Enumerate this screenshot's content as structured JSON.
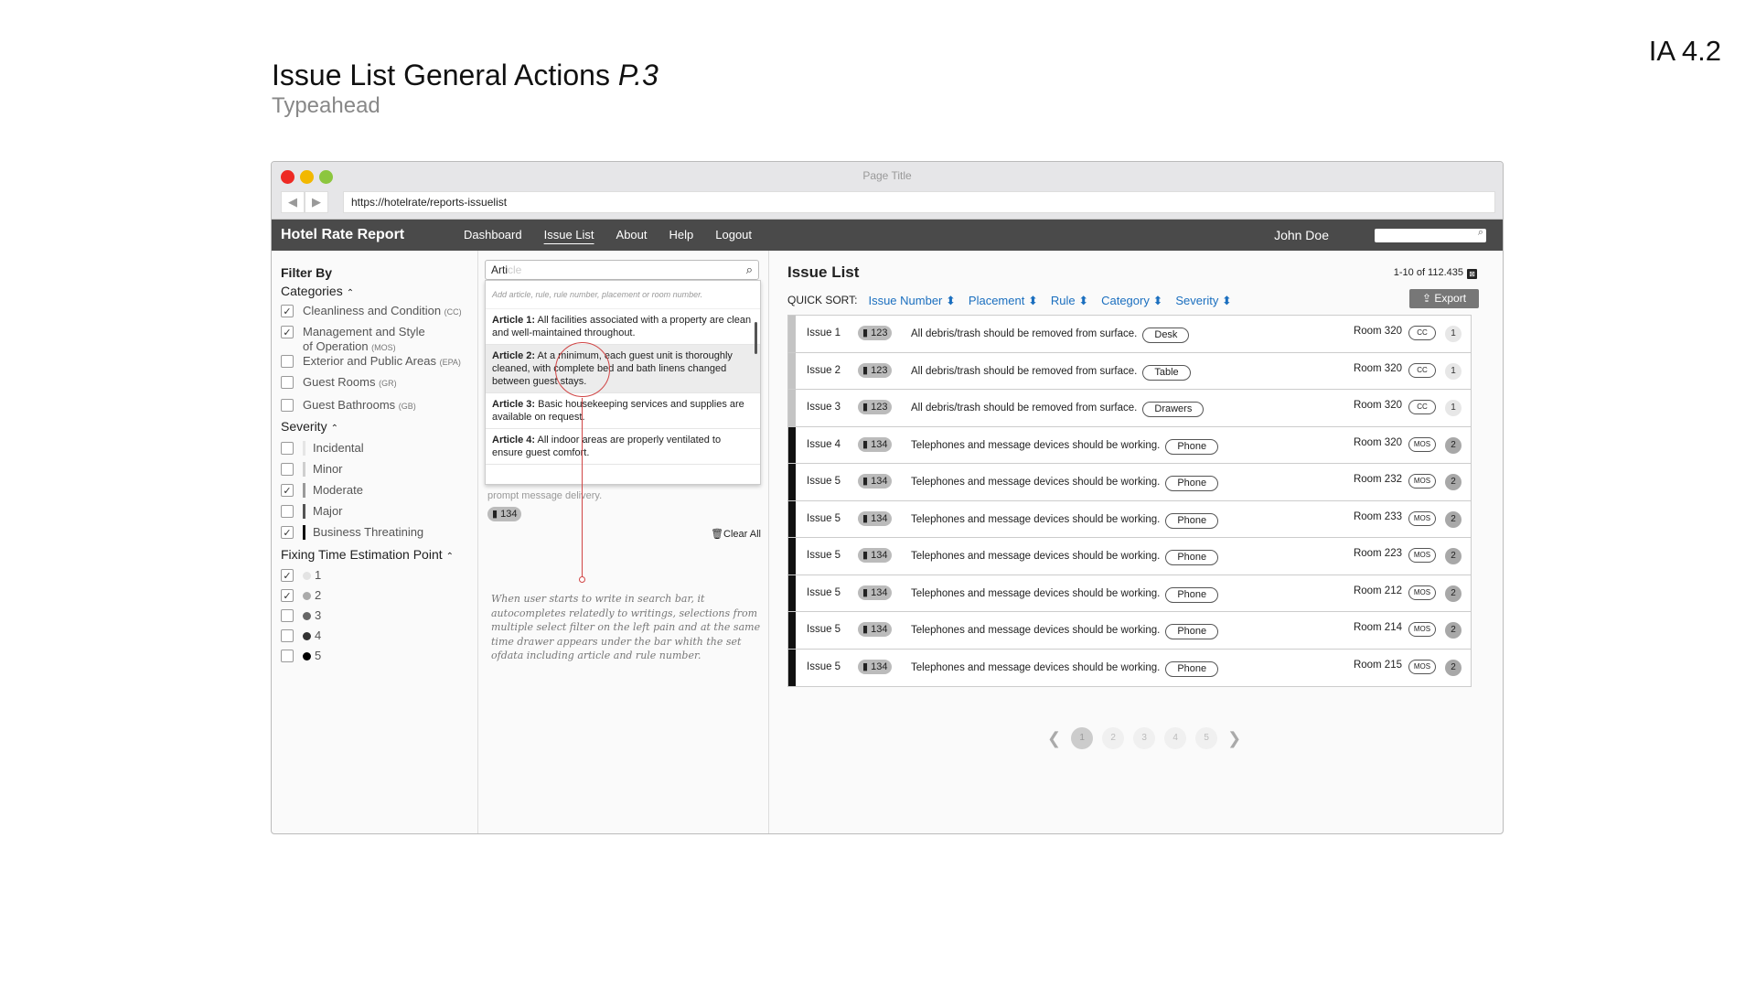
{
  "doc": {
    "title": "Issue List General Actions",
    "title_italic": "P.3",
    "subtitle": "Typeahead",
    "tag": "IA 4.2"
  },
  "browser": {
    "page_title": "Page Title",
    "url": "https://hotelrate/reports-issuelist",
    "back_label": "◀",
    "forward_label": "▶"
  },
  "appbar": {
    "brand": "Hotel Rate Report",
    "menu": [
      {
        "label": "Dashboard",
        "active": false
      },
      {
        "label": "Issue List",
        "active": true
      },
      {
        "label": "About",
        "active": false
      },
      {
        "label": "Help",
        "active": false
      },
      {
        "label": "Logout",
        "active": false
      }
    ],
    "user": "John Doe",
    "search_glyph": "⌕"
  },
  "filters": {
    "heading": "Filter By",
    "categories": {
      "label": "Categories",
      "chevron": "⌃",
      "items": [
        {
          "label": "Cleanliness and Condition",
          "code": "(CC)",
          "checked": true
        },
        {
          "label": "Management and Style",
          "label2": "of Operation",
          "code": "(MOS)",
          "checked": true
        },
        {
          "label": "Exterior and Public Areas",
          "code": "(EPA)",
          "checked": false
        },
        {
          "label": "Guest Rooms",
          "code": "(GR)",
          "checked": false
        },
        {
          "label": "Guest Bathrooms",
          "code": "(GB)",
          "checked": false
        }
      ]
    },
    "severity": {
      "label": "Severity",
      "chevron": "⌃",
      "items": [
        {
          "label": "Incidental",
          "checked": false,
          "color": "#e5e5e5"
        },
        {
          "label": "Minor",
          "checked": false,
          "color": "#cfcfcf"
        },
        {
          "label": "Moderate",
          "checked": true,
          "color": "#9a9a9a"
        },
        {
          "label": "Major",
          "checked": false,
          "color": "#555555"
        },
        {
          "label": "Business Threatining",
          "checked": true,
          "color": "#111111"
        }
      ]
    },
    "fixing": {
      "label": "Fixing Time Estimation Point",
      "chevron": "⌃",
      "items": [
        {
          "label": "1",
          "checked": true,
          "color": "#e3e3e3"
        },
        {
          "label": "2",
          "checked": true,
          "color": "#aaaaaa"
        },
        {
          "label": "3",
          "checked": false,
          "color": "#666666"
        },
        {
          "label": "4",
          "checked": false,
          "color": "#333333"
        },
        {
          "label": "5",
          "checked": false,
          "color": "#000000"
        }
      ]
    },
    "check_glyph": "✓"
  },
  "typeahead": {
    "typed": "Arti",
    "ghost": "cle",
    "glyph": "⌕",
    "hint": "Add article, rule, rule number, placement or room number.",
    "suggestions": [
      {
        "bold": "Article 1:",
        "text": " All facilities associated with a property are clean and well-maintained throughout."
      },
      {
        "bold": "Article 2:",
        "text": " At a minimum, each guest unit is thoroughly cleaned, with complete bed and bath linens changed between guest stays."
      },
      {
        "bold": "Article 3:",
        "text": " Basic housekeeping services and supplies are available on request."
      },
      {
        "bold": "Article 4:",
        "text": " All indoor areas are properly ventilated to ensure guest comfort."
      }
    ],
    "behind_text": "prompt message delivery.",
    "behind_badge": "▮ 134",
    "clear_all": "🗑Clear All",
    "annotation": "When user starts to write in search bar, it autocompletes relatedly to writings, selections from multiple select filter on the left pain and at the same time drawer appears under the bar whith the set ofdata including article and rule number."
  },
  "issues": {
    "title": "Issue List",
    "count": "1-10 of 112.435",
    "count_icon": "⊠",
    "quick_sort_label": "QUICK SORT:",
    "sort_options": [
      "Issue Number ⬍",
      "Placement ⬍",
      "Rule ⬍",
      "Category ⬍",
      "Severity ⬍"
    ],
    "export_label": "⇪ Export",
    "rows": [
      {
        "issue": "Issue 1",
        "badge": "▮ 123",
        "text": "All debris/trash should be removed from surface.",
        "pill": "Desk",
        "room": "Room 320",
        "tag": "CC",
        "num": "1",
        "sev": "#c4c4c4"
      },
      {
        "issue": "Issue 2",
        "badge": "▮ 123",
        "text": "All debris/trash should be removed from surface.",
        "pill": "Table",
        "room": "Room 320",
        "tag": "CC",
        "num": "1",
        "sev": "#c4c4c4"
      },
      {
        "issue": "Issue 3",
        "badge": "▮ 123",
        "text": "All debris/trash should be removed from surface.",
        "pill": "Drawers",
        "room": "Room 320",
        "tag": "CC",
        "num": "1",
        "sev": "#c4c4c4"
      },
      {
        "issue": "Issue 4",
        "badge": "▮ 134",
        "text": "Telephones and message devices should be working.",
        "pill": "Phone",
        "room": "Room 320",
        "tag": "MOS",
        "num": "2",
        "sev": "#111111"
      },
      {
        "issue": "Issue 5",
        "badge": "▮ 134",
        "text": "Telephones and message devices should be working.",
        "pill": "Phone",
        "room": "Room 232",
        "tag": "MOS",
        "num": "2",
        "sev": "#111111"
      },
      {
        "issue": "Issue 5",
        "badge": "▮ 134",
        "text": "Telephones and message devices should be working.",
        "pill": "Phone",
        "room": "Room 233",
        "tag": "MOS",
        "num": "2",
        "sev": "#111111"
      },
      {
        "issue": "Issue 5",
        "badge": "▮ 134",
        "text": "Telephones and message devices should be working.",
        "pill": "Phone",
        "room": "Room 223",
        "tag": "MOS",
        "num": "2",
        "sev": "#111111"
      },
      {
        "issue": "Issue 5",
        "badge": "▮ 134",
        "text": "Telephones and message devices should be working.",
        "pill": "Phone",
        "room": "Room 212",
        "tag": "MOS",
        "num": "2",
        "sev": "#111111"
      },
      {
        "issue": "Issue 5",
        "badge": "▮ 134",
        "text": "Telephones and message devices should be working.",
        "pill": "Phone",
        "room": "Room 214",
        "tag": "MOS",
        "num": "2",
        "sev": "#111111"
      },
      {
        "issue": "Issue 5",
        "badge": "▮ 134",
        "text": "Telephones and message devices should be working.",
        "pill": "Phone",
        "room": "Room 215",
        "tag": "MOS",
        "num": "2",
        "sev": "#111111"
      }
    ],
    "pager": {
      "prev": "❮",
      "next": "❯",
      "pages": [
        "1",
        "2",
        "3",
        "4",
        "5"
      ],
      "current": "1"
    }
  }
}
